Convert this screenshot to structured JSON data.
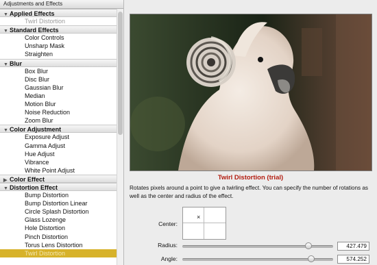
{
  "sidebar": {
    "title": "Adjustments and Effects",
    "rows": [
      {
        "kind": "group",
        "label": "Applied Effects",
        "expanded": true
      },
      {
        "kind": "item",
        "label": "Twirl Distortion",
        "state": "disabled"
      },
      {
        "kind": "group",
        "label": "Standard Effects",
        "expanded": true
      },
      {
        "kind": "item",
        "label": "Color Controls"
      },
      {
        "kind": "item",
        "label": "Unsharp Mask"
      },
      {
        "kind": "item",
        "label": "Straighten"
      },
      {
        "kind": "group",
        "label": "Blur",
        "expanded": true
      },
      {
        "kind": "item",
        "label": "Box Blur"
      },
      {
        "kind": "item",
        "label": "Disc Blur"
      },
      {
        "kind": "item",
        "label": "Gaussian Blur"
      },
      {
        "kind": "item",
        "label": "Median"
      },
      {
        "kind": "item",
        "label": "Motion Blur"
      },
      {
        "kind": "item",
        "label": "Noise Reduction"
      },
      {
        "kind": "item",
        "label": "Zoom Blur"
      },
      {
        "kind": "group",
        "label": "Color Adjustment",
        "expanded": true
      },
      {
        "kind": "item",
        "label": "Exposure Adjust"
      },
      {
        "kind": "item",
        "label": "Gamma Adjust"
      },
      {
        "kind": "item",
        "label": "Hue Adjust"
      },
      {
        "kind": "item",
        "label": "Vibrance"
      },
      {
        "kind": "item",
        "label": "White Point Adjust"
      },
      {
        "kind": "group",
        "label": "Color Effect",
        "expanded": false
      },
      {
        "kind": "group",
        "label": "Distortion Effect",
        "expanded": true
      },
      {
        "kind": "item",
        "label": "Bump Distortion"
      },
      {
        "kind": "item",
        "label": "Bump Distortion Linear"
      },
      {
        "kind": "item",
        "label": "Circle Splash Distortion"
      },
      {
        "kind": "item",
        "label": "Glass Lozenge"
      },
      {
        "kind": "item",
        "label": "Hole Distortion"
      },
      {
        "kind": "item",
        "label": "Pinch Distortion"
      },
      {
        "kind": "item",
        "label": "Torus Lens Distortion"
      },
      {
        "kind": "item",
        "label": "Twirl Distortion",
        "state": "selected"
      }
    ]
  },
  "preview": {
    "caption": "Twirl Distortion (trial)",
    "description": "Rotates pixels around a point to give a twirling effect. You can specify the number of rotations as well as the center and radius of the effect."
  },
  "params": {
    "center_label": "Center:",
    "center_marker": "×",
    "radius_label": "Radius:",
    "radius_value": "427.479",
    "radius_fraction": 0.85,
    "angle_label": "Angle:",
    "angle_value": "574.252",
    "angle_fraction": 0.87
  },
  "colors": {
    "selection": "#d7b22a",
    "caption": "#b21b0e"
  }
}
